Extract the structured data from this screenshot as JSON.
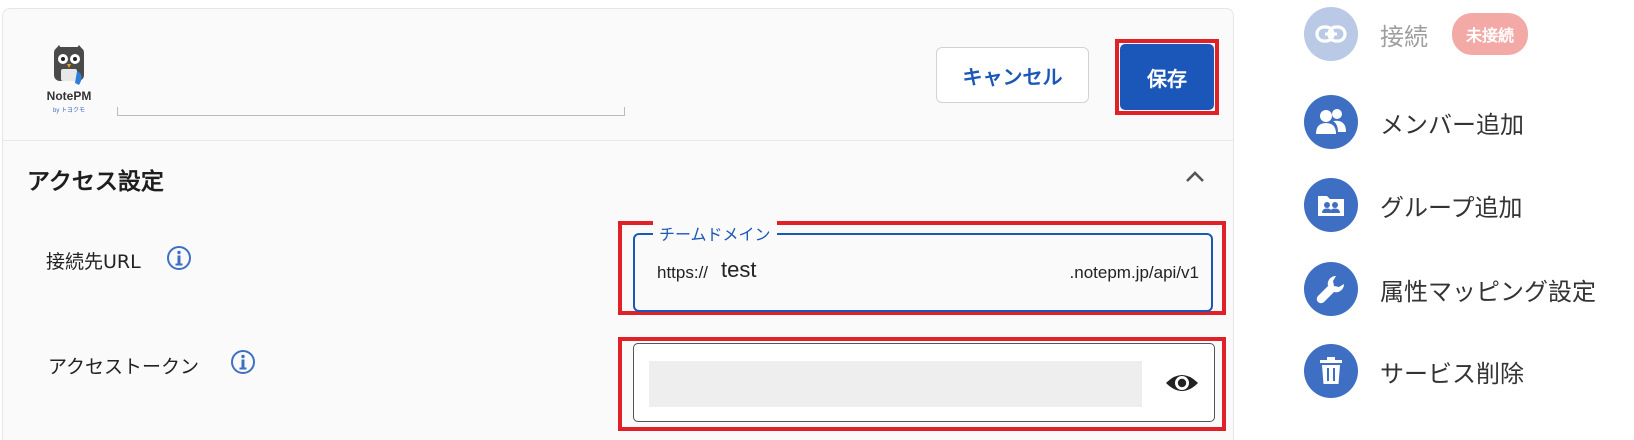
{
  "logo": {
    "brand": "NotePM",
    "by_text": "by トヨクモ"
  },
  "header": {
    "cancel_label": "キャンセル",
    "save_label": "保存"
  },
  "section": {
    "title": "アクセス設定",
    "collapse_icon": "chevron-up-icon"
  },
  "fields": {
    "url_label": "接続先URL",
    "domain_legend": "チームドメイン",
    "domain_prefix": "https://",
    "domain_value": "test",
    "domain_suffix": ".notepm.jp/api/v1",
    "token_label": "アクセストークン",
    "token_value": ""
  },
  "sidebar": {
    "items": [
      {
        "label": "接続",
        "icon": "link-icon",
        "badge": "未接続",
        "disabled": true
      },
      {
        "label": "メンバー追加",
        "icon": "users-icon"
      },
      {
        "label": "グループ追加",
        "icon": "group-folder-icon"
      },
      {
        "label": "属性マッピング設定",
        "icon": "wrench-icon"
      },
      {
        "label": "サービス削除",
        "icon": "trash-icon"
      }
    ]
  },
  "colors": {
    "primary": "#1b57b8",
    "highlight": "#e02127",
    "badge": "#f3a9a5",
    "sidebar_icon": "#3e6fc3"
  }
}
